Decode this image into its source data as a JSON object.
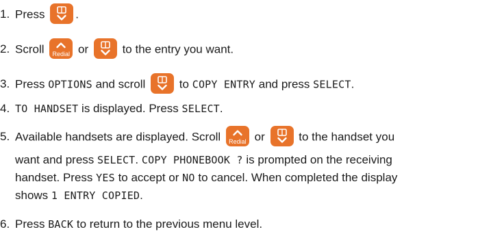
{
  "keys": {
    "redial_label": "Redial"
  },
  "steps": [
    {
      "num": "1.",
      "t1": "Press",
      "t2": "."
    },
    {
      "num": "2.",
      "t1": "Scroll",
      "t2": "or",
      "t3": "to the entry you want."
    },
    {
      "num": "3.",
      "t1": "Press",
      "d1": "OPTIONS",
      "t2": "and scroll",
      "t3": "to",
      "d2": "COPY ENTRY",
      "t4": "and press",
      "d3": "SELECT",
      "t5": "."
    },
    {
      "num": "4.",
      "d1": "TO HANDSET",
      "t1": "is displayed. Press",
      "d2": "SELECT",
      "t2": "."
    },
    {
      "num": "5.",
      "t1": "Available handsets are displayed. Scroll",
      "t2": "or",
      "t3": "to the handset you",
      "l2a": "want and press",
      "l2d1": "SELECT",
      "l2b": ".",
      "l2d2": "COPY PHONEBOOK ?",
      "l2c": "is prompted on the receiving",
      "l3a": "handset. Press",
      "l3d1": "YES",
      "l3b": "to accept or",
      "l3d2": "NO",
      "l3c": "to cancel. When completed the display",
      "l4a": "shows",
      "l4d1": "1 ENTRY COPIED",
      "l4b": "."
    },
    {
      "num": "6.",
      "t1": "Press",
      "d1": "BACK",
      "t2": "to return to the previous menu level."
    }
  ]
}
